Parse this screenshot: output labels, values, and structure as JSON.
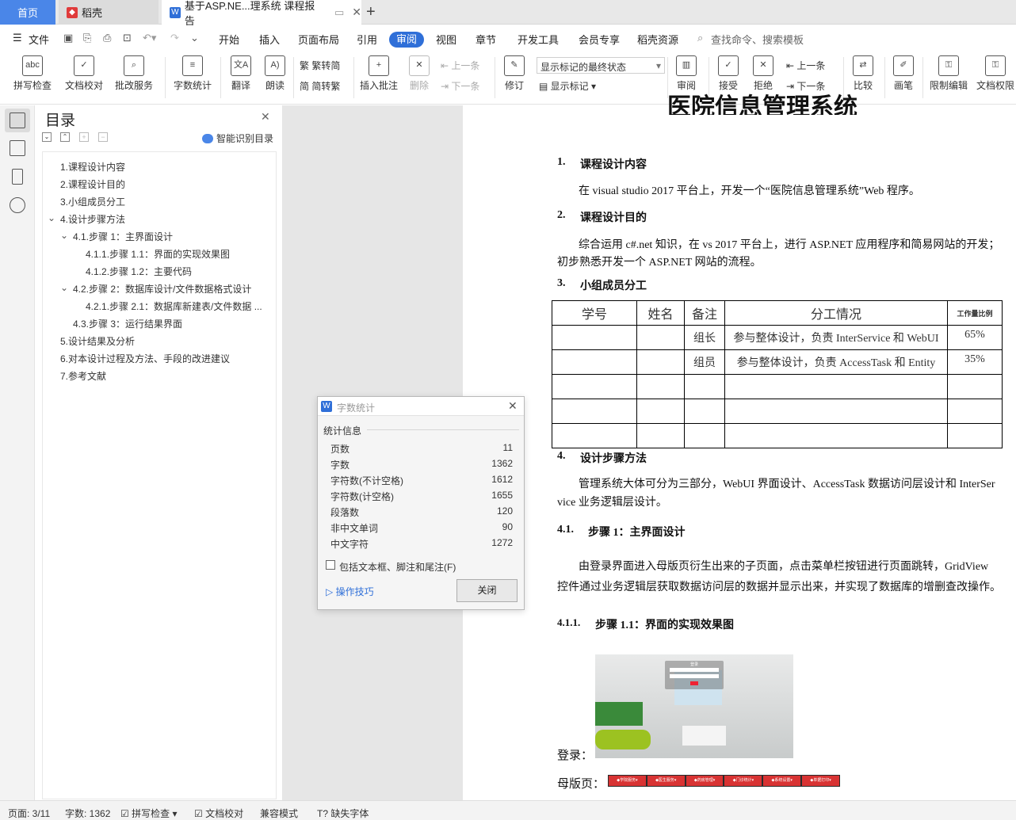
{
  "tabs": {
    "home": "首页",
    "daoke": "稻壳",
    "doc": "基于ASP.NE...理系统 课程报告",
    "new": "+"
  },
  "menu": {
    "file": "文件",
    "items": [
      "开始",
      "插入",
      "页面布局",
      "引用",
      "视图",
      "章节",
      "开发工具",
      "会员专享",
      "稻壳资源"
    ],
    "active": "审阅",
    "search": "查找命令、搜索模板"
  },
  "ribbon": {
    "spell": "拼写检查",
    "doccheck": "文档校对",
    "review_service": "批改服务",
    "wordcount": "字数统计",
    "translate": "翻译",
    "read": "朗读",
    "trad": "繁转简",
    "simp": "简转繁",
    "insert_comment": "插入批注",
    "delete": "删除",
    "prev_c": "上一条",
    "next_c": "下一条",
    "revise": "修订",
    "markup_select": "显示标记的最终状态",
    "show_markup": "显示标记",
    "review": "审阅",
    "accept": "接受",
    "reject": "拒绝",
    "prev": "上一条",
    "next": "下一条",
    "compare": "比较",
    "pen": "画笔",
    "restrict": "限制编辑",
    "perm": "文档权限"
  },
  "toc": {
    "title": "目录",
    "smart": "智能识别目录",
    "items": [
      "1.课程设计内容",
      "2.课程设计目的",
      "3.小组成员分工",
      "4.设计步骤方法",
      "4.1.步骤 1：主界面设计",
      "4.1.1.步骤 1.1：界面的实现效果图",
      "4.1.2.步骤 1.2：主要代码",
      "4.2.步骤 2：数据库设计/文件数据格式设计",
      "4.2.1.步骤 2.1：数据库新建表/文件数据 ...",
      "4.3.步骤 3：运行结果界面",
      "5.设计结果及分析",
      "6.对本设计过程及方法、手段的改进建议",
      "7.参考文献"
    ]
  },
  "doc": {
    "title": "医院信息管理系统",
    "s1": {
      "num": "1.",
      "title": "课程设计内容",
      "body": "在 visual studio 2017 平台上，开发一个“医院信息管理系统”Web 程序。"
    },
    "s2": {
      "num": "2.",
      "title": "课程设计目的",
      "body1": "综合运用 c#.net 知识，在 vs  2017 平台上，进行 ASP.NET 应用程序和简易网站的开发；",
      "body2": "初步熟悉开发一个 ASP.NET 网站的流程。"
    },
    "s3": {
      "num": "3.",
      "title": "小组成员分工"
    },
    "table": {
      "headers": [
        "学号",
        "姓名",
        "备注",
        "分工情况",
        "工作量比例"
      ],
      "rows": [
        [
          "",
          "",
          "组长",
          "参与整体设计，负责 InterService 和 WebUI",
          "65%"
        ],
        [
          "",
          "",
          "组员",
          "参与整体设计，负责 AccessTask 和 Entity",
          "35%"
        ],
        [
          "",
          "",
          "",
          "",
          ""
        ],
        [
          "",
          "",
          "",
          "",
          ""
        ],
        [
          "",
          "",
          "",
          "",
          ""
        ]
      ]
    },
    "s4": {
      "num": "4.",
      "title": "设计步骤方法",
      "body1": "管理系统大体可分为三部分，WebUI 界面设计、AccessTask 数据访问层设计和 InterSer",
      "body2": "vice 业务逻辑层设计。"
    },
    "s41": {
      "num": "4.1.",
      "title": "步骤 1：主界面设计",
      "body1": "由登录界面进入母版页衍生出来的子页面，点击菜单栏按钮进行页面跳转，GridView",
      "body2": "控件通过业务逻辑层获取数据访问层的数据并显示出来，并实现了数据库的增删查改操作。"
    },
    "s411": {
      "num": "4.1.1.",
      "title": "步骤 1.1：界面的实现效果图"
    },
    "login_label": "登录：",
    "master_label": "母版页：",
    "login_img": {
      "heading": "登录"
    },
    "master_menu": [
      "◆学院服务▾",
      "◆医生服务▾",
      "◆药房管理▾",
      "◆门诊统计▾",
      "◆系统设置▾",
      "◆单据打印▾"
    ]
  },
  "dialog": {
    "title": "字数统计",
    "section": "统计信息",
    "rows": [
      [
        "页数",
        "11"
      ],
      [
        "字数",
        "1362"
      ],
      [
        "字符数(不计空格)",
        "1612"
      ],
      [
        "字符数(计空格)",
        "1655"
      ],
      [
        "段落数",
        "120"
      ],
      [
        "非中文单词",
        "90"
      ],
      [
        "中文字符",
        "1272"
      ]
    ],
    "checkbox": "包括文本框、脚注和尾注(F)",
    "tips": "操作技巧",
    "close": "关闭"
  },
  "status": {
    "page": "页面: 3/11",
    "words": "字数: 1362",
    "spell": "拼写检查",
    "doccheck": "文档校对",
    "compat": "兼容模式",
    "font": "缺失字体"
  }
}
